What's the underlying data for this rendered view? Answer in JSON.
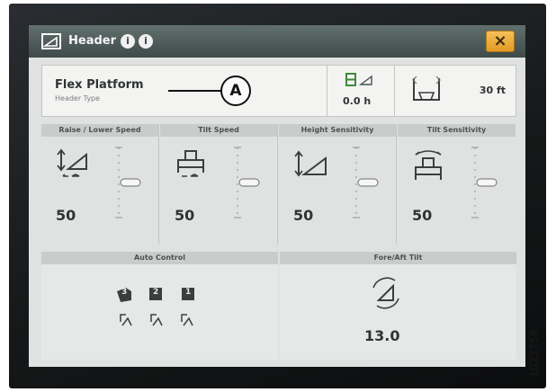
{
  "titlebar": {
    "title": "Header",
    "icons": [
      "header-icon",
      "info-icon",
      "info-icon"
    ],
    "close_label": "×"
  },
  "header_info": {
    "type_name": "Flex Platform",
    "type_label": "Header Type",
    "callout": "A",
    "hours": "0.0 h",
    "width": "30 ft"
  },
  "sensors": [
    {
      "label": "Raise / Lower Speed",
      "value": "50",
      "icon": "raise-lower-speed-icon",
      "slider_level": 0.5
    },
    {
      "label": "Tilt Speed",
      "value": "50",
      "icon": "tilt-speed-icon",
      "slider_level": 0.5
    },
    {
      "label": "Height Sensitivity",
      "value": "50",
      "icon": "height-sensitivity-icon",
      "slider_level": 0.5
    },
    {
      "label": "Tilt Sensitivity",
      "value": "50",
      "icon": "tilt-sensitivity-icon",
      "slider_level": 0.5
    }
  ],
  "auto_control": {
    "label": "Auto Control",
    "presets": [
      "3",
      "2",
      "1"
    ]
  },
  "fore_aft_tilt": {
    "label": "Fore/Aft Tilt",
    "value": "13.0"
  },
  "figure_code": "1022759",
  "colors": {
    "titlebar": "#4f5c5a",
    "close_button": "#f0ad3c",
    "panel_bg": "#dfe2e1"
  }
}
